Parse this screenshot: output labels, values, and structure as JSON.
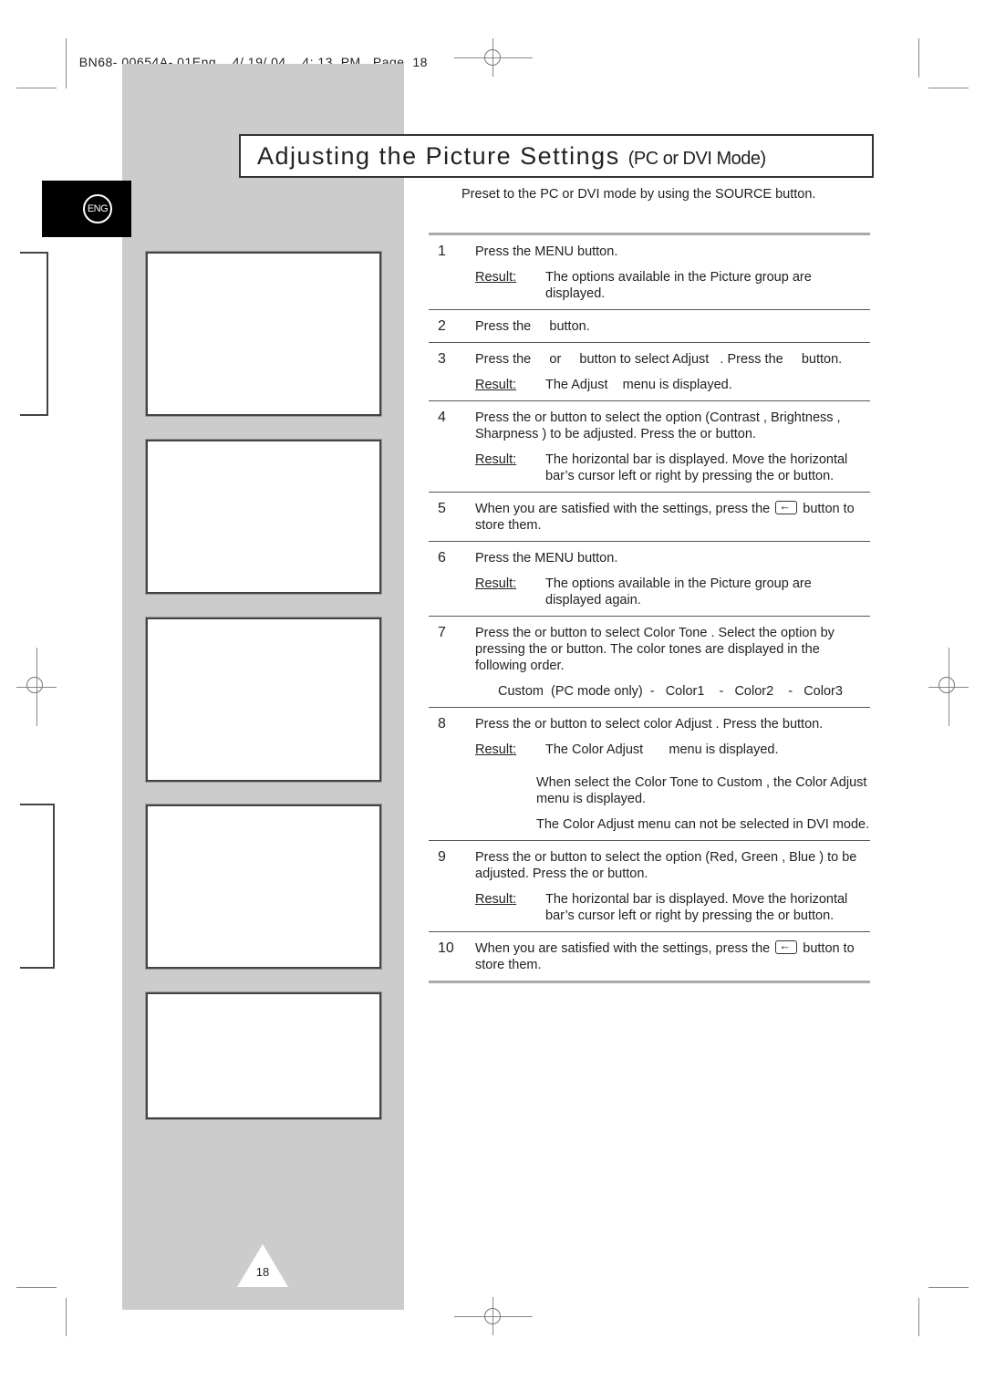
{
  "slug": {
    "doc_id": "BN68- 00654A- 01Eng",
    "date": "4/ 19/ 04",
    "time": "4: 13  PM",
    "page_label": "Page  18"
  },
  "language_tab": {
    "label": "ENG"
  },
  "title": {
    "main": "Adjusting the Picture Settings",
    "sub": "(PC or DVI Mode)"
  },
  "intro": "Preset to the PC or DVI mode by using the SOURCE button.",
  "result_label": "Result",
  "steps": [
    {
      "num": "1",
      "text": "Press the MENU button.",
      "result": "The options available in the Picture     group are displayed."
    },
    {
      "num": "2",
      "text": "Press the     button."
    },
    {
      "num": "3",
      "text": "Press the     or     button to select Adjust   . Press the     button.",
      "result": "The Adjust    menu is displayed."
    },
    {
      "num": "4",
      "text": "Press the     or     button to select the option (Contrast    , Brightness    , Sharpness   ) to be adjusted. Press the     or     button.",
      "result": "The horizontal bar is displayed. Move the horizontal bar’s cursor left or right by pressing the     or     button."
    },
    {
      "num": "5",
      "text_before": "When you are satisfied with the settings, press the",
      "text_after": "button to store them.",
      "icon": "enter-icon"
    },
    {
      "num": "6",
      "text": "Press the MENU button.",
      "result": "The options available in the Picture     group are displayed again."
    },
    {
      "num": "7",
      "text": "Press the     or     button to select Color Tone    . Select the option by pressing the     or     button. The color tones are displayed in the following order.",
      "order": "Custom  (PC mode only)  -   Color1    -   Color2    -   Color3"
    },
    {
      "num": "8",
      "text": "Press the     or     button to select color Adjust       . Press the      button.",
      "result": "The Color Adjust       menu is displayed.",
      "notes": [
        "When select the Color Tone     to Custom , the Color Adjust    menu is displayed.",
        "The Color Adjust       menu can not be selected in DVI mode."
      ]
    },
    {
      "num": "9",
      "text": "Press the     or     button to select the option (Red, Green , Blue  ) to be adjusted. Press the     or     button.",
      "result": "The horizontal bar is displayed. Move the horizontal bar’s cursor left or right by pressing the     or     button."
    },
    {
      "num": "10",
      "text_before": "When you are satisfied with the settings, press the",
      "text_after": "button to store them.",
      "icon": "enter-icon"
    }
  ],
  "page_number": "18",
  "colors": {
    "sidebar": "#cccccc",
    "tab": "#000000",
    "rule": "#aaaaaa"
  }
}
